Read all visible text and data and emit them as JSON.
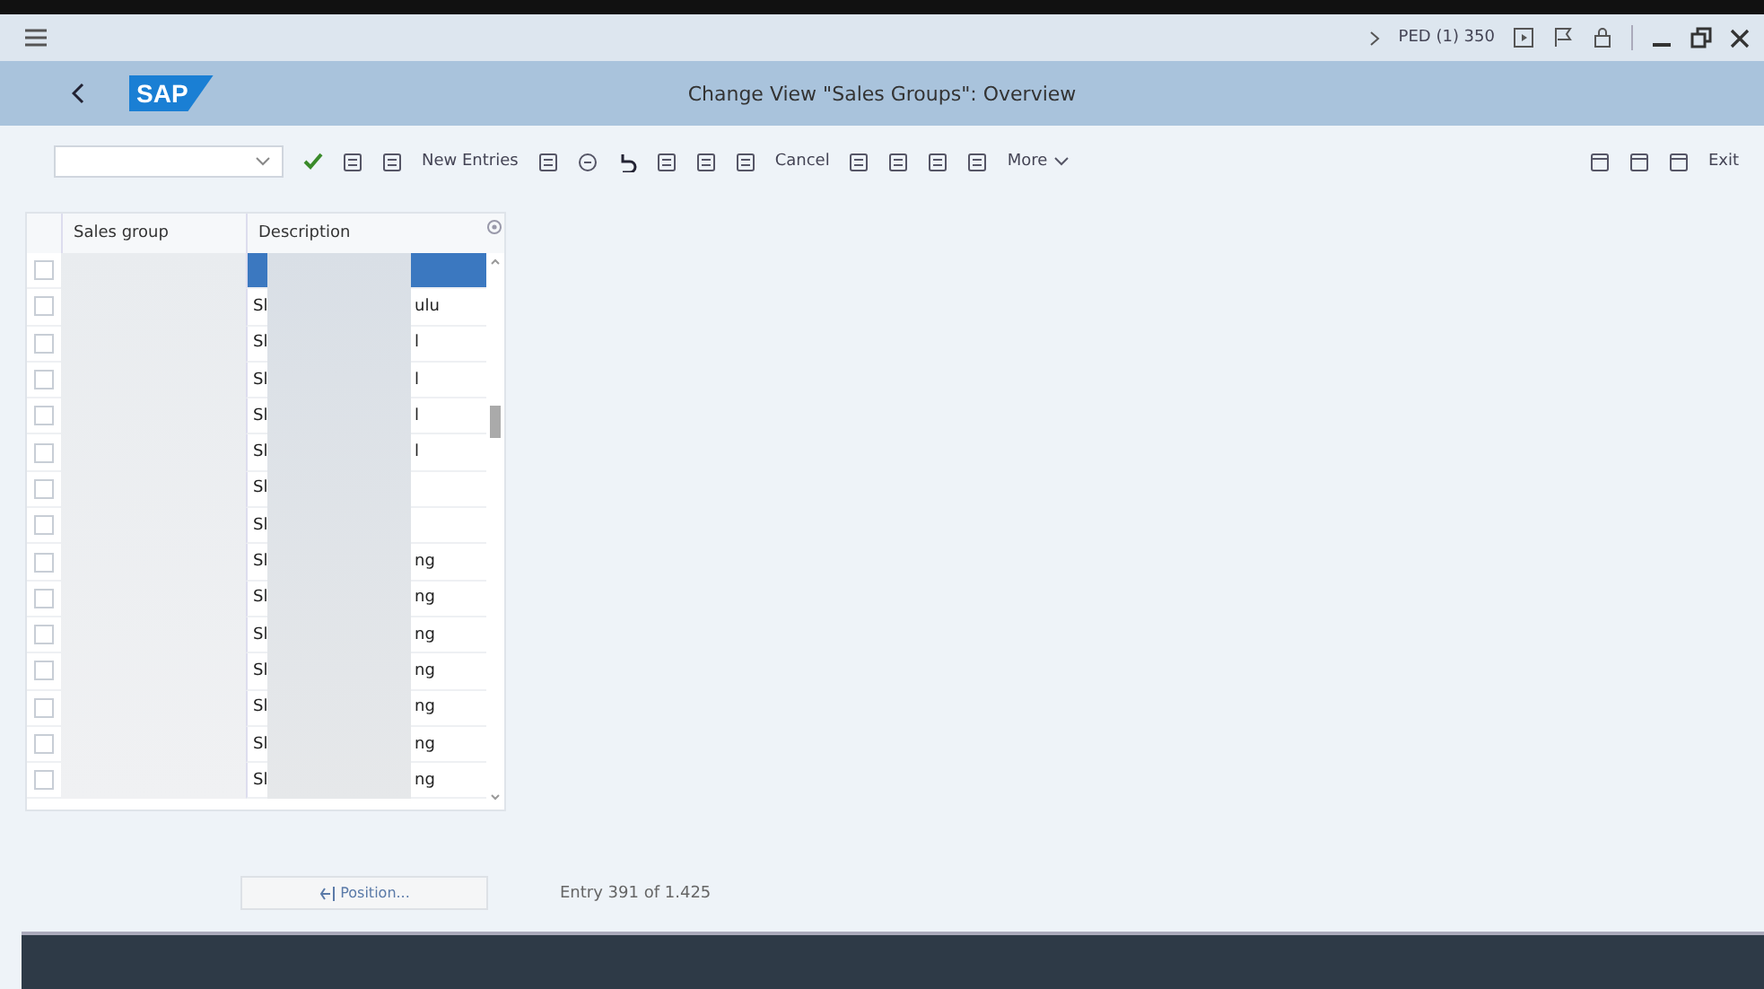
{
  "system_bar": {
    "system": "PED (1) 350"
  },
  "header": {
    "logo": "SAP",
    "title": "Change View \"Sales Groups\": Overview"
  },
  "toolbar": {
    "left": [
      {
        "kind": "select"
      },
      {
        "kind": "check"
      },
      {
        "kind": "glyph"
      },
      {
        "kind": "glyph"
      },
      {
        "kind": "button",
        "label": "New Entries"
      },
      {
        "kind": "glyph"
      },
      {
        "kind": "circle"
      },
      {
        "kind": "undo"
      },
      {
        "kind": "glyph"
      },
      {
        "kind": "glyph"
      },
      {
        "kind": "glyph"
      },
      {
        "kind": "button",
        "label": "Cancel"
      },
      {
        "kind": "glyph"
      },
      {
        "kind": "glyph"
      },
      {
        "kind": "glyph"
      },
      {
        "kind": "glyph"
      },
      {
        "kind": "menu",
        "label": "More"
      }
    ],
    "right": [
      {
        "kind": "glyph"
      },
      {
        "kind": "glyph"
      },
      {
        "kind": "glyph"
      },
      {
        "kind": "button",
        "label": "Exit"
      }
    ]
  },
  "table": {
    "columns": [
      "Sales group",
      "Description"
    ],
    "rows": [
      {
        "checked": false,
        "selected": true,
        "description_start": "",
        "description_end": ""
      },
      {
        "checked": false,
        "selected": false,
        "description_start": "Sl",
        "description_end": "ulu"
      },
      {
        "checked": false,
        "selected": false,
        "description_start": "Sl",
        "description_end": "l"
      },
      {
        "checked": false,
        "selected": false,
        "description_start": "Sl",
        "description_end": "l"
      },
      {
        "checked": false,
        "selected": false,
        "description_start": "Sl",
        "description_end": "l"
      },
      {
        "checked": false,
        "selected": false,
        "description_start": "Sl",
        "description_end": "l"
      },
      {
        "checked": false,
        "selected": false,
        "description_start": "Sl",
        "description_end": ""
      },
      {
        "checked": false,
        "selected": false,
        "description_start": "Sl",
        "description_end": ""
      },
      {
        "checked": false,
        "selected": false,
        "description_start": "Sl",
        "description_end": "ng"
      },
      {
        "checked": false,
        "selected": false,
        "description_start": "Sl",
        "description_end": "ng"
      },
      {
        "checked": false,
        "selected": false,
        "description_start": "Sl",
        "description_end": "ng"
      },
      {
        "checked": false,
        "selected": false,
        "description_start": "Sl",
        "description_end": "ng"
      },
      {
        "checked": false,
        "selected": false,
        "description_start": "Sl",
        "description_end": "ng"
      },
      {
        "checked": false,
        "selected": false,
        "description_start": "Sl",
        "description_end": "ng"
      },
      {
        "checked": false,
        "selected": false,
        "description_start": "Sl",
        "description_end": "ng"
      }
    ]
  },
  "footer": {
    "position_button": "Position...",
    "entry_info": "Entry 391 of 1.425"
  }
}
